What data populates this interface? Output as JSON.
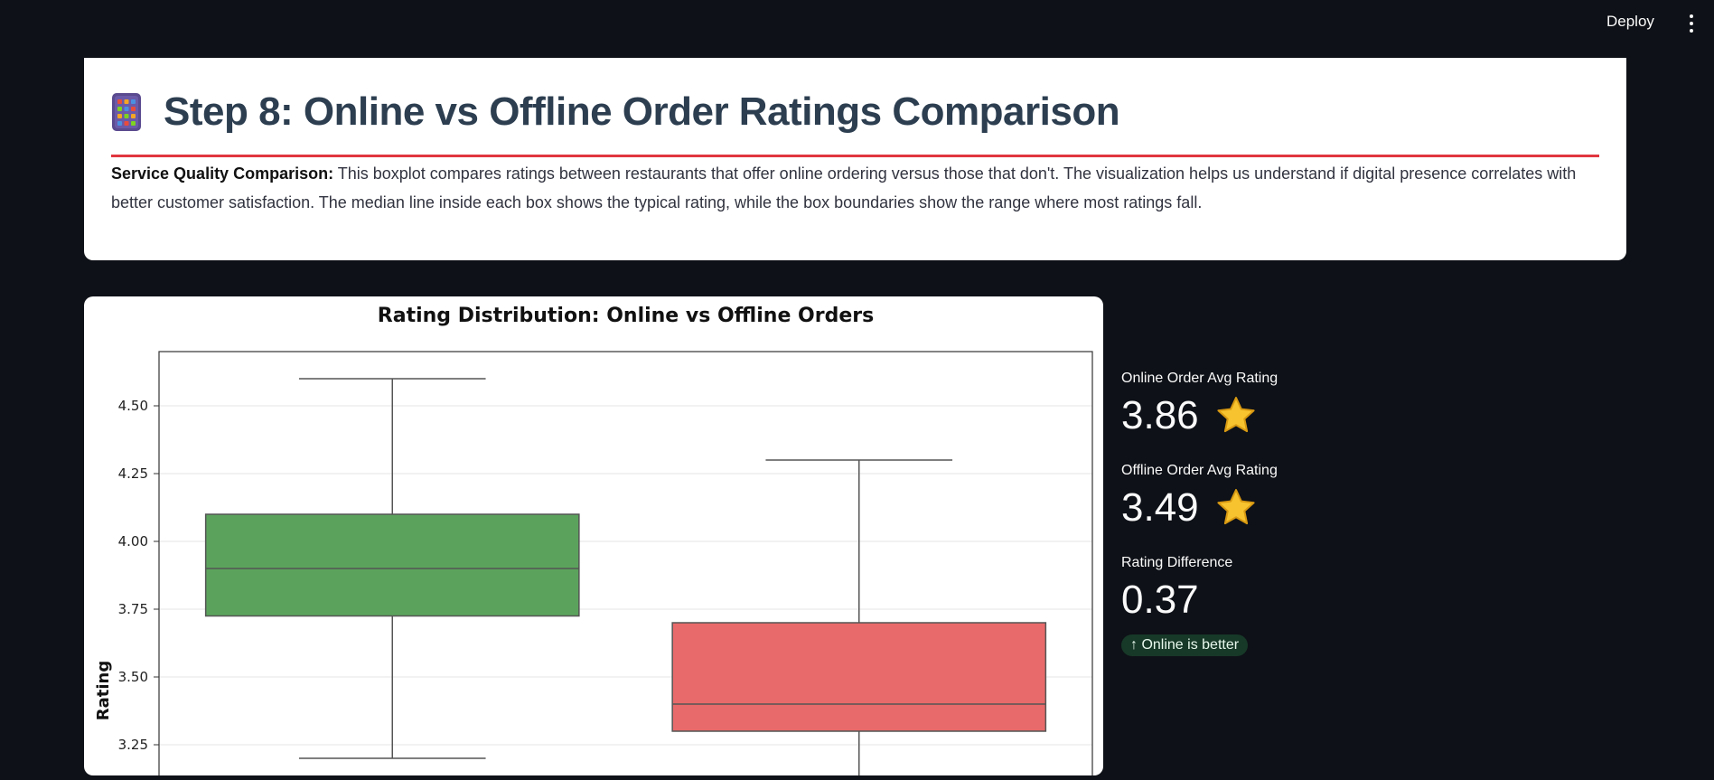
{
  "toolbar": {
    "deploy_label": "Deploy"
  },
  "header": {
    "title": "Step 8: Online vs Offline Order Ratings Comparison",
    "desc_bold": "Service Quality Comparison:",
    "desc_text": " This boxplot compares ratings between restaurants that offer online ordering versus those that don't. The visualization helps us understand if digital presence correlates with better customer satisfaction. The median line inside each box shows the typical rating, while the box boundaries show the range where most ratings fall."
  },
  "metrics": {
    "online_label": "Online Order Avg Rating",
    "online_value": "3.86",
    "offline_label": "Offline Order Avg Rating",
    "offline_value": "3.49",
    "diff_label": "Rating Difference",
    "diff_value": "0.37",
    "diff_delta": "↑ Online is better"
  },
  "colors": {
    "online_box": "#5ba35d",
    "offline_box": "#e96a6a",
    "accent_rule": "#e0363f",
    "delta_bg": "#173928"
  },
  "chart_data": {
    "type": "box",
    "title": "Rating Distribution: Online vs Offline Orders",
    "ylabel": "Rating",
    "ylim": [
      3.15,
      4.7
    ],
    "yticks": [
      3.25,
      3.5,
      3.75,
      4.0,
      4.25,
      4.5
    ],
    "ytick_labels": [
      "3.25",
      "3.50",
      "3.75",
      "4.00",
      "4.25",
      "4.50"
    ],
    "grid": true,
    "series": [
      {
        "whisker_low": 3.2,
        "q1": 3.725,
        "median": 3.9,
        "q3": 4.1,
        "whisker_high": 4.6,
        "color": "#5ba35d"
      },
      {
        "whisker_low": null,
        "q1": 3.3,
        "median": 3.4,
        "q3": 3.7,
        "whisker_high": 4.3,
        "color": "#e96a6a"
      }
    ]
  }
}
